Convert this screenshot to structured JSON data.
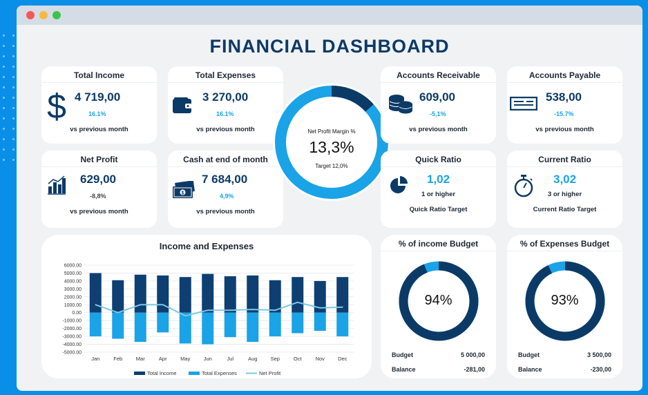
{
  "header": {
    "title": "FINANCIAL DASHBOARD"
  },
  "colors": {
    "navy": "#0c3a66",
    "dark_bar": "#0d3f72",
    "light_bar": "#1aa3e6",
    "net_line": "#7cc7ea",
    "accent": "#1aa3e6"
  },
  "kpis": {
    "total_income": {
      "title": "Total Income",
      "value": "4 719,00",
      "change": "16.1%",
      "note": "vs previous month",
      "icon": "dollar-icon"
    },
    "total_expenses": {
      "title": "Total Expenses",
      "value": "3 270,00",
      "change": "16.1%",
      "note": "vs previous month",
      "icon": "wallet-icon"
    },
    "net_profit": {
      "title": "Net Profit",
      "value": "629,00",
      "change": "-8,8%",
      "note": "vs previous month",
      "icon": "bar-chart-icon"
    },
    "cash": {
      "title": "Cash at end of month",
      "value": "7 684,00",
      "change": "4,9%",
      "note": "vs previous month",
      "icon": "money-icon"
    },
    "receivable": {
      "title": "Accounts Receivable",
      "value": "609,00",
      "change": "-5,1%",
      "note": "vs previous month",
      "icon": "coins-icon"
    },
    "payable": {
      "title": "Accounts Payable",
      "value": "538,00",
      "change": "-15.7%",
      "note": "vs previous month",
      "icon": "check-icon"
    },
    "quick_ratio": {
      "title": "Quick Ratio",
      "value": "1,02",
      "note": "1 or higher",
      "target": "Quick Ratio Target",
      "icon": "pie-chart-icon"
    },
    "current_ratio": {
      "title": "Current Ratio",
      "value": "3,02",
      "note": "3 or higher",
      "target": "Current Ratio Target",
      "icon": "stopwatch-icon"
    }
  },
  "margin": {
    "label": "Net Profit Margin %",
    "value": "13,3%",
    "target": "Target 12,0%",
    "fraction": 0.133
  },
  "income_budget": {
    "title": "% of income Budget",
    "value": "94%",
    "fraction": 0.94,
    "budget_label": "Budget",
    "budget": "5 000,00",
    "balance_label": "Balance",
    "balance": "-281,00"
  },
  "expenses_budget": {
    "title": "% of Expenses Budget",
    "value": "93%",
    "fraction": 0.93,
    "budget_label": "Budget",
    "budget": "3 500,00",
    "balance_label": "Balance",
    "balance": "-230,00"
  },
  "chart_data": {
    "type": "bar",
    "title": "Income and Expenses",
    "categories": [
      "Jan",
      "Feb",
      "Mar",
      "Apr",
      "May",
      "Jun",
      "Jul",
      "Aug",
      "Sep",
      "Oct",
      "Nov",
      "Dec"
    ],
    "ylim": [
      -5000,
      6000
    ],
    "yticks": [
      "6000.00",
      "5000.00",
      "4000.00",
      "3000.00",
      "2000.00",
      "1000.00",
      "0.00",
      "-1000.00",
      "-2000.00",
      "-3000.00",
      "-4000.00",
      "-5000.00"
    ],
    "grid": true,
    "legend_position": "bottom",
    "series": [
      {
        "name": "Total Income",
        "type": "bar",
        "values": [
          5000,
          4100,
          4800,
          4700,
          4500,
          4900,
          4600,
          4700,
          4100,
          4500,
          4000,
          4500
        ]
      },
      {
        "name": "Total Expenses",
        "type": "bar",
        "values": [
          -3000,
          -3300,
          -3700,
          -2500,
          -3900,
          -4000,
          -3100,
          -3700,
          -3000,
          -2600,
          -2300,
          -3000
        ]
      },
      {
        "name": "Net Profit",
        "type": "line",
        "values": [
          1000,
          0,
          1000,
          1000,
          -400,
          300,
          300,
          400,
          300,
          1300,
          600,
          700
        ]
      }
    ]
  }
}
